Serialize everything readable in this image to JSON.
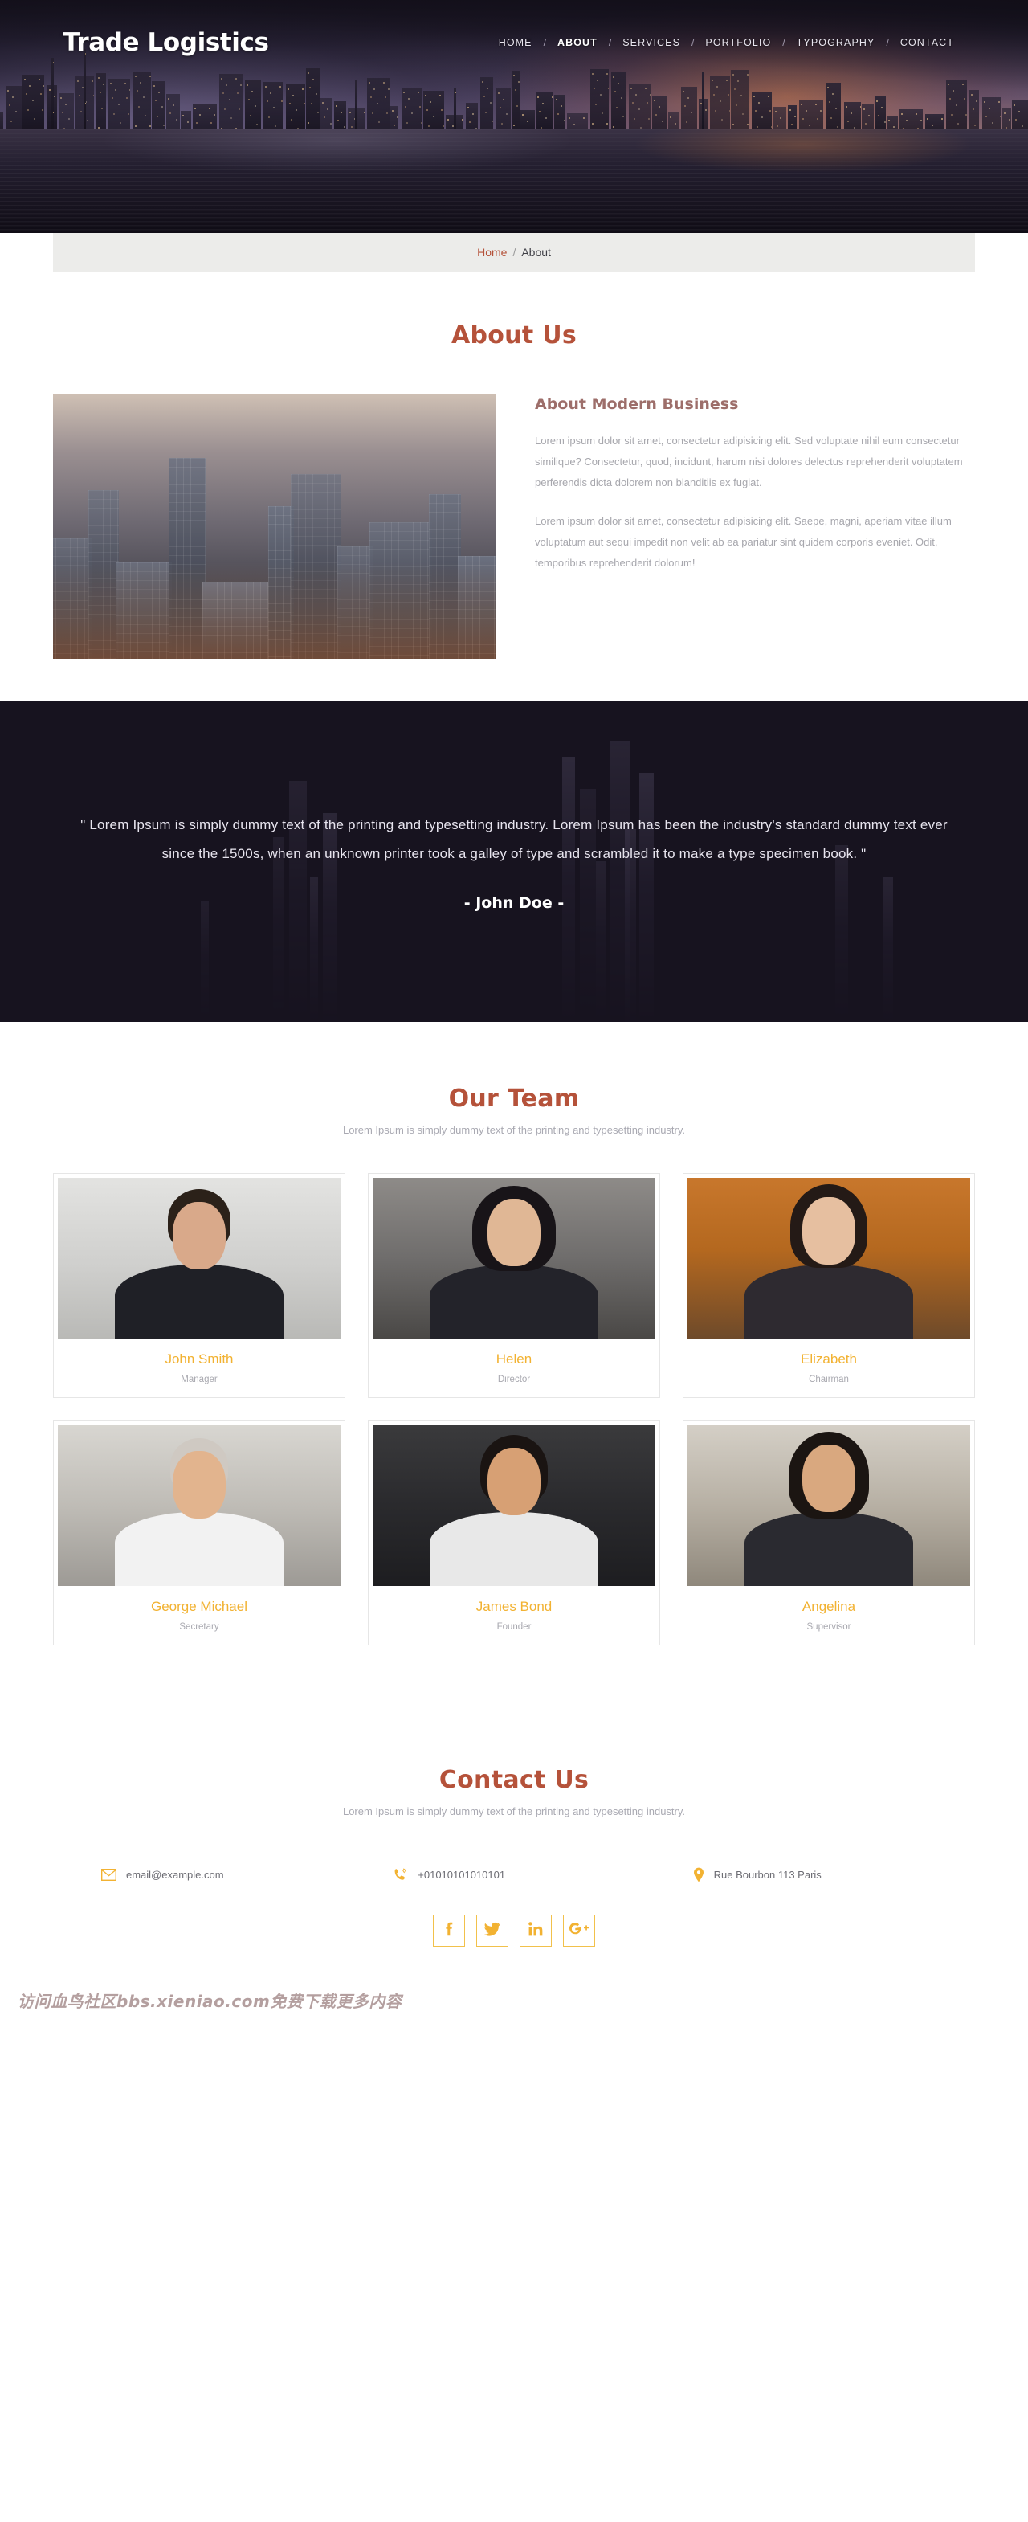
{
  "header": {
    "brand": "Trade Logistics",
    "nav": [
      {
        "label": "HOME",
        "active": false
      },
      {
        "label": "ABOUT",
        "active": true
      },
      {
        "label": "SERVICES",
        "active": false
      },
      {
        "label": "PORTFOLIO",
        "active": false
      },
      {
        "label": "TYPOGRAPHY",
        "active": false
      },
      {
        "label": "CONTACT",
        "active": false
      }
    ],
    "nav_separator": "/"
  },
  "breadcrumb": {
    "home": "Home",
    "separator": "/",
    "current": "About"
  },
  "about": {
    "title": "About Us",
    "subtitle": "About Modern Business",
    "paragraph1": "Lorem ipsum dolor sit amet, consectetur adipisicing elit. Sed voluptate nihil eum consectetur similique? Consectetur, quod, incidunt, harum nisi dolores delectus reprehenderit voluptatem perferendis dicta dolorem non blanditiis ex fugiat.",
    "paragraph2": "Lorem ipsum dolor sit amet, consectetur adipisicing elit. Saepe, magni, aperiam vitae illum voluptatum aut sequi impedit non velit ab ea pariatur sint quidem corporis eveniet. Odit, temporibus reprehenderit dolorum!"
  },
  "quote": {
    "text": "\" Lorem Ipsum is simply dummy text of the printing and typesetting industry. Lorem Ipsum has been the industry's standard dummy text ever since the 1500s, when an unknown printer took a galley of type and scrambled it to make a type specimen book. \"",
    "author": "- John Doe -"
  },
  "team": {
    "title": "Our Team",
    "subtitle": "Lorem Ipsum is simply dummy text of the printing and typesetting industry.",
    "members": [
      {
        "name": "John Smith",
        "role": "Manager"
      },
      {
        "name": "Helen",
        "role": "Director"
      },
      {
        "name": "Elizabeth",
        "role": "Chairman"
      },
      {
        "name": "George Michael",
        "role": "Secretary"
      },
      {
        "name": "James Bond",
        "role": "Founder"
      },
      {
        "name": "Angelina",
        "role": "Supervisor"
      }
    ]
  },
  "contact": {
    "title": "Contact Us",
    "subtitle": "Lorem Ipsum is simply dummy text of the printing and typesetting industry.",
    "email": "email@example.com",
    "phone": "+01010101010101",
    "address": "Rue Bourbon 113 Paris",
    "socials": [
      {
        "icon": "facebook-icon",
        "label": "f"
      },
      {
        "icon": "twitter-icon",
        "label": "t"
      },
      {
        "icon": "linkedin-icon",
        "label": "in"
      },
      {
        "icon": "google-plus-icon",
        "label": "G+"
      }
    ]
  },
  "footer": {
    "watermark": "访问血鸟社区bbs.xieniao.com免费下载更多内容"
  },
  "colors": {
    "accent_rust": "#b5523a",
    "accent_gold": "#f2b232",
    "muted_text": "#a7a7ad",
    "dark_bg": "#17131f"
  }
}
